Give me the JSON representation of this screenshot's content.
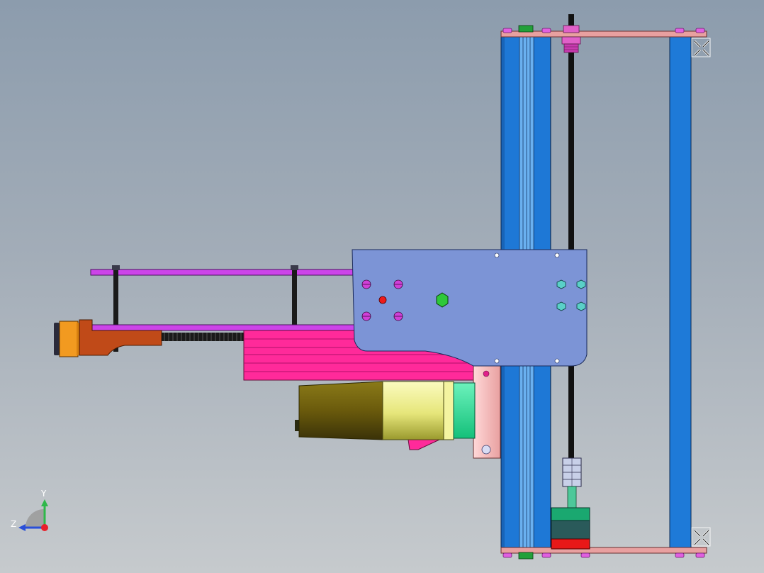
{
  "viewport": {
    "background_top": "#8c9cad",
    "background_bottom": "#c6cacd"
  },
  "triad": {
    "y_label": "Y",
    "z_label": "Z",
    "x_axis_color": "#e8202a",
    "y_axis_color": "#2fb84a",
    "z_axis_color": "#2a4fd8"
  },
  "colors": {
    "rail_blue": "#1e78d6",
    "carriage_plate": "#7c94d6",
    "magenta_arm": "#ff2a9a",
    "purple_bar": "#cc44e8",
    "motor_yellow": "#e6e67a",
    "motor_green": "#26e89a",
    "stepper_orange": "#f29a20",
    "bracket_brown": "#c04a18",
    "pink_frame": "#e8a0a0"
  },
  "icons": [
    "move-handle-icon",
    "move-handle-icon",
    "view-triad-icon"
  ]
}
